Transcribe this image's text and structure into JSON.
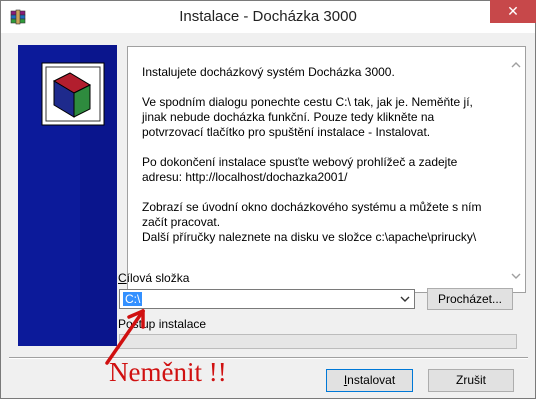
{
  "window": {
    "title": "Instalace - Docházka 3000",
    "close_glyph": "✕"
  },
  "info": {
    "paragraphs": [
      "Instalujete docházkový systém Docházka 3000.",
      "Ve spodním dialogu ponechte cestu C:\\ tak, jak je. Neměňte jí,\njinak nebude docházka funkční. Pouze tedy klikněte na\npotvrzovací tlačítko pro spuštění instalace - Instalovat.",
      "Po dokončení instalace spusťte webový prohlížeč a zadejte\nadresu: http://localhost/dochazka2001/",
      "Zobrazí se úvodní okno docházkového systému a můžete s ním\nzačít pracovat.\nDalší příručky naleznete na disku ve složce c:\\apache\\prirucky\\"
    ]
  },
  "target_folder": {
    "label_first": "C",
    "label_rest": "ílová složka",
    "value": "C:\\"
  },
  "browse_button": {
    "label": "Procházet..."
  },
  "progress": {
    "label": "Postup instalace",
    "value": 0
  },
  "buttons": {
    "install_first": "I",
    "install_rest": "nstalovat",
    "cancel": "Zrušit"
  },
  "annotation": {
    "text": "Neměnit !!"
  },
  "colors": {
    "banner": "#0c1a9a",
    "selection": "#3390ff",
    "close": "#c7484a",
    "annotation": "#d01010"
  }
}
